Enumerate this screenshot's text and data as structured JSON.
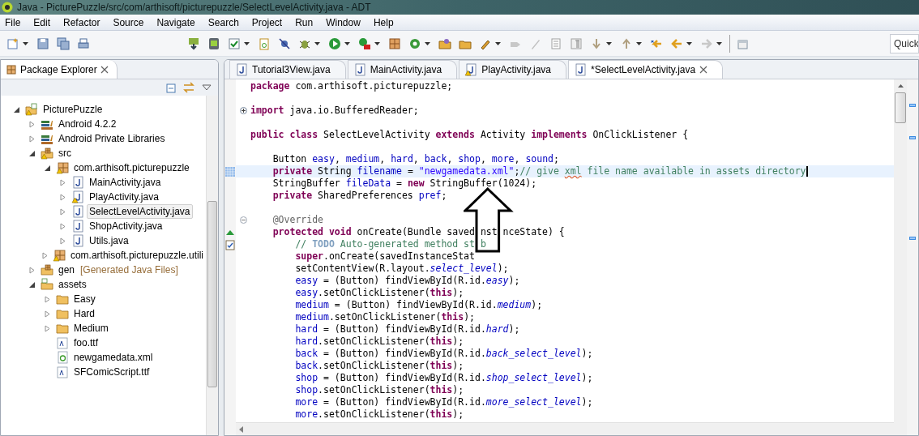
{
  "window": {
    "title": "Java - PicturePuzzle/src/com/arthisoft/picturepuzzle/SelectLevelActivity.java - ADT"
  },
  "menu": [
    {
      "label": "File"
    },
    {
      "label": "Edit"
    },
    {
      "label": "Refactor"
    },
    {
      "label": "Source"
    },
    {
      "label": "Navigate"
    },
    {
      "label": "Search"
    },
    {
      "label": "Project"
    },
    {
      "label": "Run"
    },
    {
      "label": "Window"
    },
    {
      "label": "Help"
    }
  ],
  "quick_access": {
    "placeholder": "Quick"
  },
  "package_explorer": {
    "title": "Package Explorer",
    "tree": [
      {
        "label": "PicturePuzzle",
        "kind": "project",
        "warning": true,
        "expanded": true,
        "selected": false,
        "children": [
          {
            "label": "Android 4.2.2",
            "kind": "library",
            "warning": false,
            "expanded": false,
            "selected": false
          },
          {
            "label": "Android Private Libraries",
            "kind": "library",
            "warning": false,
            "expanded": false,
            "selected": false
          },
          {
            "label": "src",
            "kind": "source",
            "warning": true,
            "expanded": true,
            "selected": false,
            "children": [
              {
                "label": "com.arthisoft.picturepuzzle",
                "kind": "package",
                "warning": true,
                "expanded": true,
                "selected": false,
                "children": [
                  {
                    "label": "MainActivity.java",
                    "kind": "java",
                    "warning": false,
                    "expanded": false,
                    "selected": false
                  },
                  {
                    "label": "PlayActivity.java",
                    "kind": "java",
                    "warning": true,
                    "expanded": false,
                    "selected": false
                  },
                  {
                    "label": "SelectLevelActivity.java",
                    "kind": "java",
                    "warning": false,
                    "expanded": false,
                    "selected": true
                  },
                  {
                    "label": "ShopActivity.java",
                    "kind": "java",
                    "warning": false,
                    "expanded": false,
                    "selected": false
                  },
                  {
                    "label": "Utils.java",
                    "kind": "java",
                    "warning": false,
                    "expanded": false,
                    "selected": false
                  }
                ]
              },
              {
                "label": "com.arthisoft.picturepuzzle.utili",
                "kind": "package",
                "warning": true,
                "expanded": false,
                "selected": false
              }
            ]
          },
          {
            "label": "gen",
            "decoration": "[Generated Java Files]",
            "kind": "source",
            "warning": false,
            "expanded": false,
            "selected": false
          },
          {
            "label": "assets",
            "kind": "assets",
            "warning": false,
            "expanded": true,
            "selected": false,
            "children": [
              {
                "label": "Easy",
                "kind": "folder",
                "warning": false,
                "expanded": false,
                "selected": false
              },
              {
                "label": "Hard",
                "kind": "folder",
                "warning": false,
                "expanded": false,
                "selected": false
              },
              {
                "label": "Medium",
                "kind": "folder",
                "warning": false,
                "expanded": false,
                "selected": false
              },
              {
                "label": "foo.ttf",
                "kind": "font",
                "warning": false,
                "selected": false
              },
              {
                "label": "newgamedata.xml",
                "kind": "xml",
                "warning": false,
                "selected": false
              },
              {
                "label": "SFComicScript.ttf",
                "kind": "font",
                "warning": false,
                "selected": false
              }
            ]
          }
        ]
      }
    ]
  },
  "editor_tabs": [
    {
      "label": "Tutorial3View.java",
      "warning": false,
      "selected": false
    },
    {
      "label": "MainActivity.java",
      "warning": false,
      "selected": false
    },
    {
      "label": "PlayActivity.java",
      "warning": true,
      "selected": false
    },
    {
      "label": "*SelectLevelActivity.java",
      "warning": false,
      "selected": true
    }
  ],
  "code": [
    {
      "kind": "code",
      "tokens": [
        {
          "kind": "keyword",
          "text": "package"
        },
        {
          "kind": "plain",
          "text": " com.arthisoft.picturepuzzle;"
        }
      ]
    },
    {
      "kind": "blank"
    },
    {
      "kind": "code",
      "folded": true,
      "tokens": [
        {
          "kind": "keyword",
          "text": "import"
        },
        {
          "kind": "plain",
          "text": " java.io.BufferedReader;"
        }
      ]
    },
    {
      "kind": "blank"
    },
    {
      "kind": "code",
      "tokens": [
        {
          "kind": "keyword",
          "text": "public class"
        },
        {
          "kind": "plain",
          "text": " SelectLevelActivity "
        },
        {
          "kind": "keyword",
          "text": "extends"
        },
        {
          "kind": "plain",
          "text": " Activity "
        },
        {
          "kind": "keyword",
          "text": "implements"
        },
        {
          "kind": "plain",
          "text": " OnClickListener {"
        }
      ]
    },
    {
      "kind": "blank"
    },
    {
      "kind": "code",
      "tokens": [
        {
          "kind": "plain",
          "text": "    Button "
        },
        {
          "kind": "field",
          "text": "easy"
        },
        {
          "kind": "plain",
          "text": ", "
        },
        {
          "kind": "field",
          "text": "medium"
        },
        {
          "kind": "plain",
          "text": ", "
        },
        {
          "kind": "field",
          "text": "hard"
        },
        {
          "kind": "plain",
          "text": ", "
        },
        {
          "kind": "field",
          "text": "back"
        },
        {
          "kind": "plain",
          "text": ", "
        },
        {
          "kind": "field",
          "text": "shop"
        },
        {
          "kind": "plain",
          "text": ", "
        },
        {
          "kind": "field",
          "text": "more"
        },
        {
          "kind": "plain",
          "text": ", "
        },
        {
          "kind": "field",
          "text": "sound"
        },
        {
          "kind": "plain",
          "text": ";"
        }
      ]
    },
    {
      "kind": "code",
      "current": true,
      "marker": {
        "kind": "occurrence"
      },
      "tokens": [
        {
          "kind": "keyword",
          "text": "    private"
        },
        {
          "kind": "plain",
          "text": " String "
        },
        {
          "kind": "field",
          "text": "filename"
        },
        {
          "kind": "plain",
          "text": " = "
        },
        {
          "kind": "string",
          "text": "\"newgamedata.xml\""
        },
        {
          "kind": "plain",
          "text": ";"
        },
        {
          "kind": "comment",
          "text": "// give "
        },
        {
          "kind": "misspelled",
          "text": "xml"
        },
        {
          "kind": "comment",
          "text": " file name available in assets directory"
        }
      ]
    },
    {
      "kind": "code",
      "tokens": [
        {
          "kind": "plain",
          "text": "    StringBuffer "
        },
        {
          "kind": "field",
          "text": "fileData"
        },
        {
          "kind": "plain",
          "text": " = "
        },
        {
          "kind": "keyword",
          "text": "new"
        },
        {
          "kind": "plain",
          "text": " StringBuffer(1024);"
        }
      ]
    },
    {
      "kind": "code",
      "tokens": [
        {
          "kind": "keyword",
          "text": "    private"
        },
        {
          "kind": "plain",
          "text": " SharedPreferences "
        },
        {
          "kind": "field",
          "text": "pref"
        },
        {
          "kind": "plain",
          "text": ";"
        }
      ]
    },
    {
      "kind": "blank"
    },
    {
      "kind": "code",
      "folded": false,
      "tokens": [
        {
          "kind": "annotation",
          "text": "    @Override"
        }
      ]
    },
    {
      "kind": "code",
      "marker": {
        "kind": "override"
      },
      "tokens": [
        {
          "kind": "keyword",
          "text": "    protected void"
        },
        {
          "kind": "plain",
          "text": " onCreate(Bundle saved"
        },
        {
          "kind": "gap"
        },
        {
          "kind": "plain",
          "text": "nst"
        },
        {
          "kind": "gap"
        },
        {
          "kind": "plain",
          "text": "nceState) {"
        }
      ]
    },
    {
      "kind": "code",
      "marker": {
        "kind": "task"
      },
      "tokens": [
        {
          "kind": "comment",
          "text": "        // "
        },
        {
          "kind": "todo",
          "text": "TODO"
        },
        {
          "kind": "comment",
          "text": " Auto-generated method st"
        },
        {
          "kind": "gap"
        },
        {
          "kind": "comment",
          "text": "b"
        }
      ]
    },
    {
      "kind": "code",
      "tokens": [
        {
          "kind": "keyword",
          "text": "        super"
        },
        {
          "kind": "plain",
          "text": ".onCreate(savedInstanceStat"
        }
      ]
    },
    {
      "kind": "code",
      "tokens": [
        {
          "kind": "plain",
          "text": "        setContentView(R.layout."
        },
        {
          "kind": "static",
          "text": "select_level"
        },
        {
          "kind": "plain",
          "text": ");"
        }
      ]
    },
    {
      "kind": "code",
      "tokens": [
        {
          "kind": "field",
          "text": "        easy"
        },
        {
          "kind": "plain",
          "text": " = (Button) findViewById(R.id."
        },
        {
          "kind": "static",
          "text": "easy"
        },
        {
          "kind": "plain",
          "text": ");"
        }
      ]
    },
    {
      "kind": "code",
      "tokens": [
        {
          "kind": "field",
          "text": "        easy"
        },
        {
          "kind": "plain",
          "text": ".setOnClickListener("
        },
        {
          "kind": "keyword",
          "text": "this"
        },
        {
          "kind": "plain",
          "text": ");"
        }
      ]
    },
    {
      "kind": "code",
      "tokens": [
        {
          "kind": "field",
          "text": "        medium"
        },
        {
          "kind": "plain",
          "text": " = (Button) findViewById(R.id."
        },
        {
          "kind": "static",
          "text": "medium"
        },
        {
          "kind": "plain",
          "text": ");"
        }
      ]
    },
    {
      "kind": "code",
      "tokens": [
        {
          "kind": "field",
          "text": "        medium"
        },
        {
          "kind": "plain",
          "text": ".setOnClickListener("
        },
        {
          "kind": "keyword",
          "text": "this"
        },
        {
          "kind": "plain",
          "text": ");"
        }
      ]
    },
    {
      "kind": "code",
      "tokens": [
        {
          "kind": "field",
          "text": "        hard"
        },
        {
          "kind": "plain",
          "text": " = (Button) findViewById(R.id."
        },
        {
          "kind": "static",
          "text": "hard"
        },
        {
          "kind": "plain",
          "text": ");"
        }
      ]
    },
    {
      "kind": "code",
      "tokens": [
        {
          "kind": "field",
          "text": "        hard"
        },
        {
          "kind": "plain",
          "text": ".setOnClickListener("
        },
        {
          "kind": "keyword",
          "text": "this"
        },
        {
          "kind": "plain",
          "text": ");"
        }
      ]
    },
    {
      "kind": "code",
      "tokens": [
        {
          "kind": "field",
          "text": "        back"
        },
        {
          "kind": "plain",
          "text": " = (Button) findViewById(R.id."
        },
        {
          "kind": "static",
          "text": "back_select_level"
        },
        {
          "kind": "plain",
          "text": ");"
        }
      ]
    },
    {
      "kind": "code",
      "tokens": [
        {
          "kind": "field",
          "text": "        back"
        },
        {
          "kind": "plain",
          "text": ".setOnClickListener("
        },
        {
          "kind": "keyword",
          "text": "this"
        },
        {
          "kind": "plain",
          "text": ");"
        }
      ]
    },
    {
      "kind": "code",
      "tokens": [
        {
          "kind": "field",
          "text": "        shop"
        },
        {
          "kind": "plain",
          "text": " = (Button) findViewById(R.id."
        },
        {
          "kind": "static",
          "text": "shop_select_level"
        },
        {
          "kind": "plain",
          "text": ");"
        }
      ]
    },
    {
      "kind": "code",
      "tokens": [
        {
          "kind": "field",
          "text": "        shop"
        },
        {
          "kind": "plain",
          "text": ".setOnClickListener("
        },
        {
          "kind": "keyword",
          "text": "this"
        },
        {
          "kind": "plain",
          "text": ");"
        }
      ]
    },
    {
      "kind": "code",
      "tokens": [
        {
          "kind": "field",
          "text": "        more"
        },
        {
          "kind": "plain",
          "text": " = (Button) findViewById(R.id."
        },
        {
          "kind": "static",
          "text": "more_select_level"
        },
        {
          "kind": "plain",
          "text": ");"
        }
      ]
    },
    {
      "kind": "code",
      "tokens": [
        {
          "kind": "field",
          "text": "        more"
        },
        {
          "kind": "plain",
          "text": ".setOnClickListener("
        },
        {
          "kind": "keyword",
          "text": "this"
        },
        {
          "kind": "plain",
          "text": ");"
        }
      ]
    }
  ]
}
